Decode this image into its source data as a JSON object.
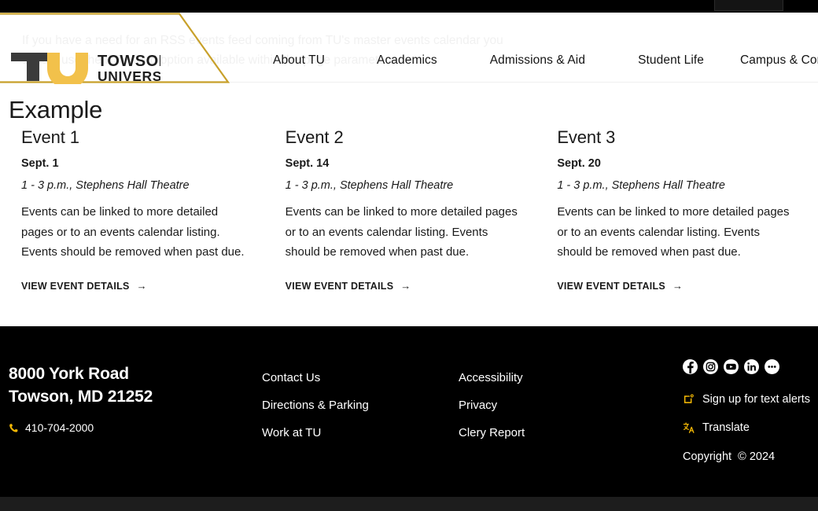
{
  "topbar": {
    "utility_box": ""
  },
  "header": {
    "ghost_text": "If you have a need for an RSS events feed coming from TU's master events calendar you should use the RSS feed option available within the page parameters.",
    "logo": {
      "monogram": "TU",
      "line1": "TOWSON",
      "line2": "UNIVERSITY"
    },
    "nav": [
      {
        "label": "About TU"
      },
      {
        "label": "Academics"
      },
      {
        "label": "Admissions & Aid"
      },
      {
        "label": "Student Life"
      },
      {
        "label": "Campus & Community"
      }
    ]
  },
  "main": {
    "page_title": "Example",
    "events": [
      {
        "title": "Event 1",
        "date": "Sept. 1",
        "time": "1 - 3 p.m., Stephens Hall Theatre",
        "description": "Events can be linked to more detailed pages or to an events calendar listing. Events should be removed when past due.",
        "link_label": "VIEW EVENT DETAILS",
        "link_arrow": "→"
      },
      {
        "title": "Event 2",
        "date": "Sept. 14",
        "time": "1 - 3 p.m., Stephens Hall Theatre",
        "description": "Events can be linked to more detailed pages or to an events calendar listing. Events should be removed when past due.",
        "link_label": "VIEW EVENT DETAILS",
        "link_arrow": "→"
      },
      {
        "title": "Event 3",
        "date": "Sept. 20",
        "time": "1 - 3 p.m., Stephens Hall Theatre",
        "description": "Events can be linked to more detailed pages or to an events calendar listing. Events should be removed when past due.",
        "link_label": "VIEW EVENT DETAILS",
        "link_arrow": "→"
      }
    ]
  },
  "footer": {
    "address_line1": "8000 York Road",
    "address_line2": "Towson, MD 21252",
    "phone": "410-704-2000",
    "links_col1": [
      {
        "label": "Contact Us"
      },
      {
        "label": "Directions & Parking"
      },
      {
        "label": "Work at TU"
      }
    ],
    "links_col2": [
      {
        "label": "Accessibility"
      },
      {
        "label": "Privacy"
      },
      {
        "label": "Clery Report"
      }
    ],
    "socials": [
      {
        "name": "facebook"
      },
      {
        "name": "instagram"
      },
      {
        "name": "youtube"
      },
      {
        "name": "linkedin"
      },
      {
        "name": "more"
      }
    ],
    "text_alerts_label": "Sign up for text alerts",
    "translate_label": "Translate",
    "copyright": "Copyright  © 2024"
  },
  "colors": {
    "gold": "#c8a02a",
    "logo_gold": "#f2c14b",
    "logo_dark": "#3b3b3b",
    "black": "#000000",
    "bottom_bar": "#1d1d1d",
    "text": "#1a1a1a"
  }
}
